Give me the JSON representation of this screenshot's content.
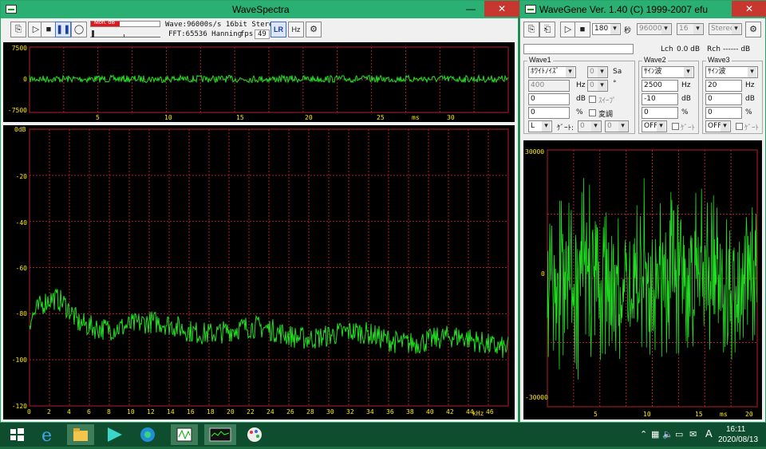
{
  "wavespectra": {
    "title": "WaveSpectra",
    "level_label": "Mon. dB",
    "info_line1": "Wave:96000s/s 16bit Stereo",
    "info_line2_prefix": "FFT:65536 Hanning",
    "fps_label": "fps:",
    "fps_value": "49",
    "btn_lr": "LR",
    "btn_hz": "Hz",
    "wave": {
      "y_ticks": [
        "7500",
        "0",
        "-7500"
      ],
      "x_ticks": [
        "5",
        "10",
        "15",
        "20",
        "25",
        "30"
      ],
      "x_unit": "ms"
    },
    "spectrum": {
      "y_ticks": [
        "0dB",
        "-20",
        "-40",
        "-60",
        "-80",
        "-100",
        "-120"
      ],
      "x_ticks": [
        "0",
        "2",
        "4",
        "6",
        "8",
        "10",
        "12",
        "14",
        "16",
        "18",
        "20",
        "22",
        "24",
        "26",
        "28",
        "30",
        "32",
        "34",
        "36",
        "38",
        "40",
        "42",
        "44",
        "46"
      ],
      "x_unit": "kHz"
    }
  },
  "wavegene": {
    "title": "WaveGene  Ver. 1.40  (C) 1999-2007 efu",
    "duration": "180",
    "duration_unit": "秒",
    "rate": "96000",
    "bits": "16",
    "channels": "Stereo",
    "lch_label": "Lch",
    "lch_value": "0.0 dB",
    "rch_label": "Rch",
    "rch_value": "------ dB",
    "wave1": {
      "label": "Wave1",
      "type": "ﾎﾜｲﾄﾉｲｽﾞ",
      "sa_value": "0",
      "sa_label": "Sa",
      "freq": "400",
      "freq_unit": "Hz",
      "phase": "0",
      "phase_unit": "°",
      "level": "0",
      "level_unit": "dB",
      "sweep_label": "ｽｲｰﾌﾟ",
      "offset": "0",
      "offset_unit": "%",
      "mod_label": "変調",
      "level2": "0",
      "level2_unit": "dB",
      "ch": "L",
      "gate_label": "ｹﾞｰﾄ:",
      "gate1": "0",
      "gate2": "0"
    },
    "wave2": {
      "label": "Wave2",
      "type": "ｻｲﾝ波",
      "freq": "2500",
      "freq_unit": "Hz",
      "level": "-10",
      "level_unit": "dB",
      "offset": "0",
      "offset_unit": "%",
      "out": "OFF",
      "gate_label": "ｹﾞｰﾄ"
    },
    "wave3": {
      "label": "Wave3",
      "type": "ｻｲﾝ波",
      "freq": "20",
      "freq_unit": "Hz",
      "level": "0",
      "level_unit": "dB",
      "offset": "0",
      "offset_unit": "%",
      "out": "OFF",
      "gate_label": "ｹﾞｰﾄ"
    },
    "scope": {
      "y_ticks": [
        "30000",
        "0",
        "-30000"
      ],
      "x_ticks": [
        "5",
        "10",
        "15",
        "20"
      ],
      "x_unit": "ms"
    }
  },
  "taskbar": {
    "time": "16:11",
    "date": "2020/08/13",
    "ime": "A"
  },
  "colors": {
    "trace": "#21e021",
    "grid": "#b0202a",
    "label": "#ffe600",
    "titlebar": "#2bb073"
  }
}
